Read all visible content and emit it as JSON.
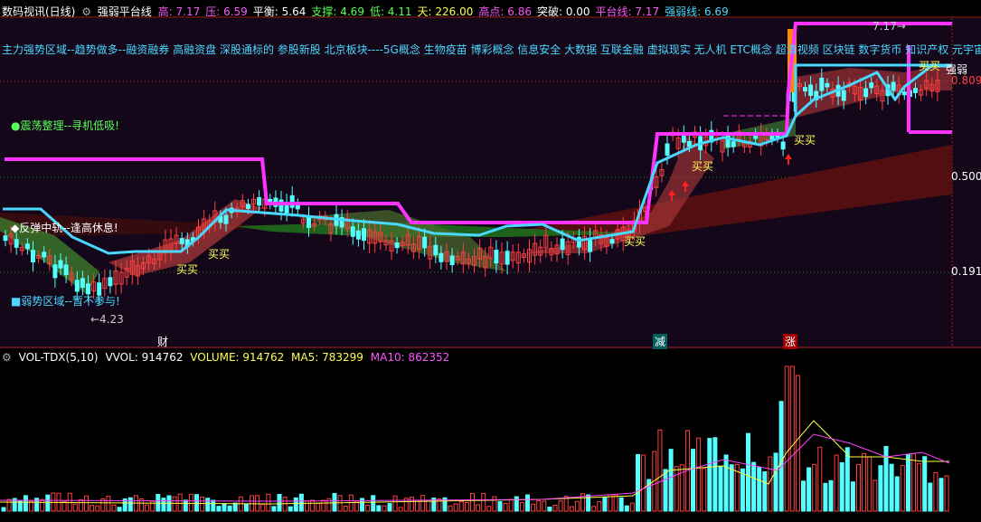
{
  "header": {
    "title": "数码视讯(日线)",
    "indicator": "强弱平台线",
    "items": [
      {
        "label": "高:",
        "value": "7.17",
        "color": "#ff55ff"
      },
      {
        "label": "压:",
        "value": "6.59",
        "color": "#ff55ff"
      },
      {
        "label": "平衡:",
        "value": "5.64",
        "color": "#ffffff"
      },
      {
        "label": "支撑:",
        "value": "4.69",
        "color": "#55ff55"
      },
      {
        "label": "低:",
        "value": "4.11",
        "color": "#55ff55"
      },
      {
        "label": "天:",
        "value": "226.00",
        "color": "#ffff55"
      },
      {
        "label": "高点:",
        "value": "6.86",
        "color": "#ff55ff"
      },
      {
        "label": "突破:",
        "value": "0.00",
        "color": "#ffffff"
      },
      {
        "label": "平台线:",
        "value": "7.17",
        "color": "#ff55ff"
      },
      {
        "label": "强弱线:",
        "value": "6.69",
        "color": "#4ad8ff"
      }
    ]
  },
  "sectors": "主力强势区域--趋势做多--融资融券 高融资盘 深股通标的 参股新股 北京板块----5G概念 生物疫苗 博彩概念 信息安全 大数据 互联金融 虚拟现实 无人机 ETC概念 超清视频 区块链 数字货币 知识产权 元宇宙",
  "chart_labels": {
    "zhendang": "●震荡整理--寻机低吸!",
    "fantan": "◆反弹中轨--逢高休息!",
    "ruoshi": "■弱势区域--暂不参与!",
    "low_mark": "←4.23",
    "high_mark": "7.17→",
    "strong_mark": "强弱",
    "buy": "买买",
    "marker_cai": "财",
    "marker_jian": "减",
    "marker_zhang": "涨"
  },
  "axis": {
    "labels": [
      "0.809",
      "0.500",
      "0.191"
    ]
  },
  "volume": {
    "title": "VOL-TDX(5,10)",
    "vvol": "VVOL: 914762",
    "volume": "VOLUME: 914762",
    "ma5": "MA5: 783299",
    "ma10": "MA10: 862352"
  },
  "colors": {
    "up": "#ff4040",
    "down": "#54ffff",
    "platform": "#ff33ff",
    "strong": "#4ad8ff",
    "ma5": "#ffff40",
    "ma10": "#ff40ff"
  }
}
